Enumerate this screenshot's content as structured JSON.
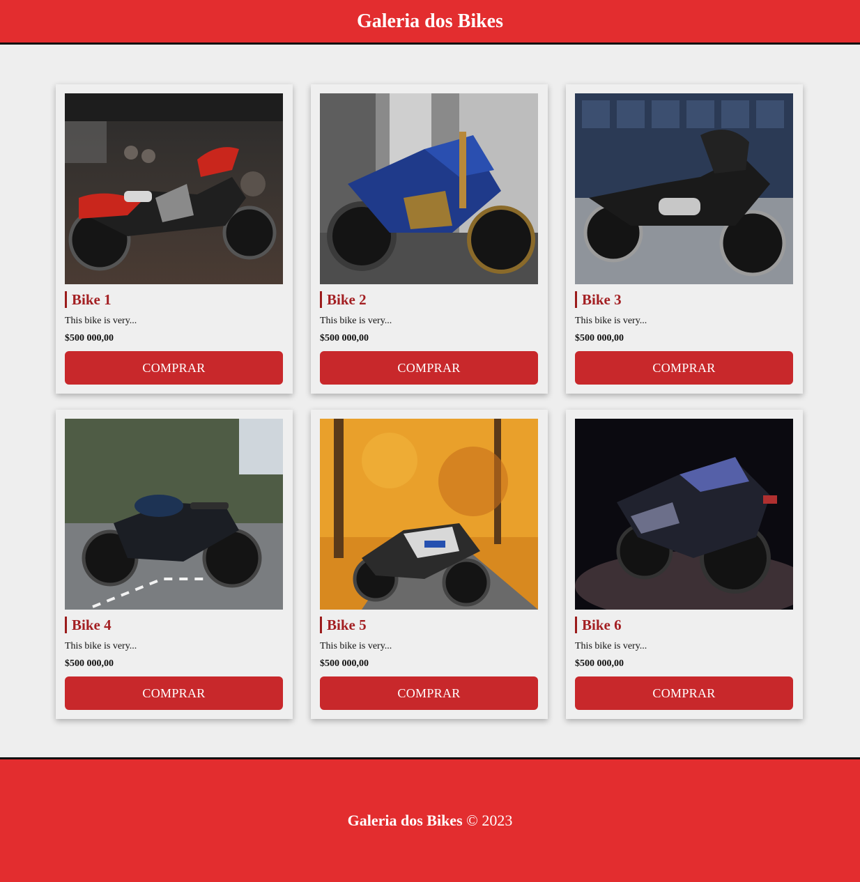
{
  "header": {
    "title": "Galeria dos Bikes"
  },
  "colors": {
    "brand_red": "#e32d2f",
    "button_red": "#c8282b",
    "title_red": "#a31f22",
    "background": "#eeeeee"
  },
  "products": [
    {
      "title": "Bike 1",
      "description": "This bike is very...",
      "price": "$500 000,00",
      "button": "COMPRAR"
    },
    {
      "title": "Bike 2",
      "description": "This bike is very...",
      "price": "$500 000,00",
      "button": "COMPRAR"
    },
    {
      "title": "Bike 3",
      "description": "This bike is very...",
      "price": "$500 000,00",
      "button": "COMPRAR"
    },
    {
      "title": "Bike 4",
      "description": "This bike is very...",
      "price": "$500 000,00",
      "button": "COMPRAR"
    },
    {
      "title": "Bike 5",
      "description": "This bike is very...",
      "price": "$500 000,00",
      "button": "COMPRAR"
    },
    {
      "title": "Bike 6",
      "description": "This bike is very...",
      "price": "$500 000,00",
      "button": "COMPRAR"
    }
  ],
  "footer": {
    "brand": "Galeria dos Bikes",
    "copyright": "© 2023"
  }
}
